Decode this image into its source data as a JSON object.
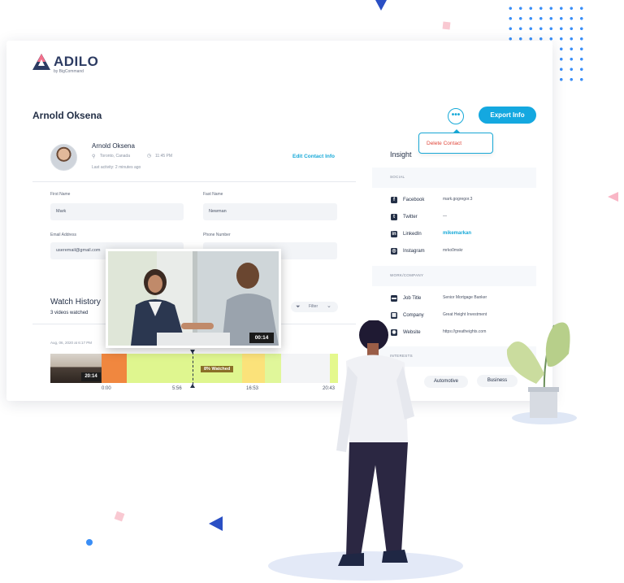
{
  "brand": {
    "name": "ADILO",
    "tagline": "by BigCommand"
  },
  "page": {
    "title": "Arnold Oksena"
  },
  "actions": {
    "more_symbol": "•••",
    "export_label": "Export Info",
    "menu_delete": "Delete Contact"
  },
  "contact": {
    "name": "Arnold Oksena",
    "location": "Toronto, Canada",
    "time": "11:45 PM",
    "last_activity": "Last activity: 2 minutes ago",
    "edit_label": "Edit Contact Info"
  },
  "fields": {
    "first_name": {
      "label": "First Name",
      "value": "Mark"
    },
    "last_name": {
      "label": "Fast Name",
      "value": "Newman"
    },
    "email": {
      "label": "Email Address",
      "value": "useremail@gmail.com"
    },
    "phone": {
      "label": "Phone Number",
      "value": ""
    }
  },
  "watch_history": {
    "title": "Watch History",
    "subtitle": "3 videos watched",
    "filter_label": "Filter",
    "session_date": "Aug, 06, 2020 at 6:17 PM",
    "thumb_duration": "20:14",
    "popup_duration": "00:14",
    "watched_label": "8% Watched",
    "ticks": [
      "0:00",
      "5:56",
      "16:53",
      "20:43"
    ],
    "heatmap_colors": [
      "#f0873f",
      "#dff68f",
      "#dff68f",
      "#fbe27a",
      "#e0f79a",
      "#f3f4f6",
      "#e4f88d"
    ]
  },
  "insight": {
    "title": "Insight",
    "social_header": "SOCIAL",
    "social": [
      {
        "icon": "facebook-icon",
        "glyph": "f",
        "label": "Facebook",
        "value": "mark.gogregor.3"
      },
      {
        "icon": "twitter-icon",
        "glyph": "t",
        "label": "Twitter",
        "value": "—"
      },
      {
        "icon": "linkedin-icon",
        "glyph": "in",
        "label": "LinkedIn",
        "value": "mikemarkan"
      },
      {
        "icon": "instagram-icon",
        "glyph": "◎",
        "label": "Instagram",
        "value": "mrko0mskr"
      }
    ],
    "work_header": "WORK/COMPANY",
    "work": [
      {
        "icon": "briefcase-icon",
        "glyph": "▬",
        "label": "Job Title",
        "value": "Senior Mortgage Banker"
      },
      {
        "icon": "building-icon",
        "glyph": "▦",
        "label": "Company",
        "value": "Great Height Investment"
      },
      {
        "icon": "globe-icon",
        "glyph": "◉",
        "label": "Website",
        "value": "https://greatheights.com"
      }
    ],
    "interests_header": "INTERESTS",
    "interests": [
      "Automotive",
      "Business"
    ]
  },
  "colors": {
    "accent": "#14a8e0",
    "danger": "#e0463a",
    "navy": "#243047"
  }
}
